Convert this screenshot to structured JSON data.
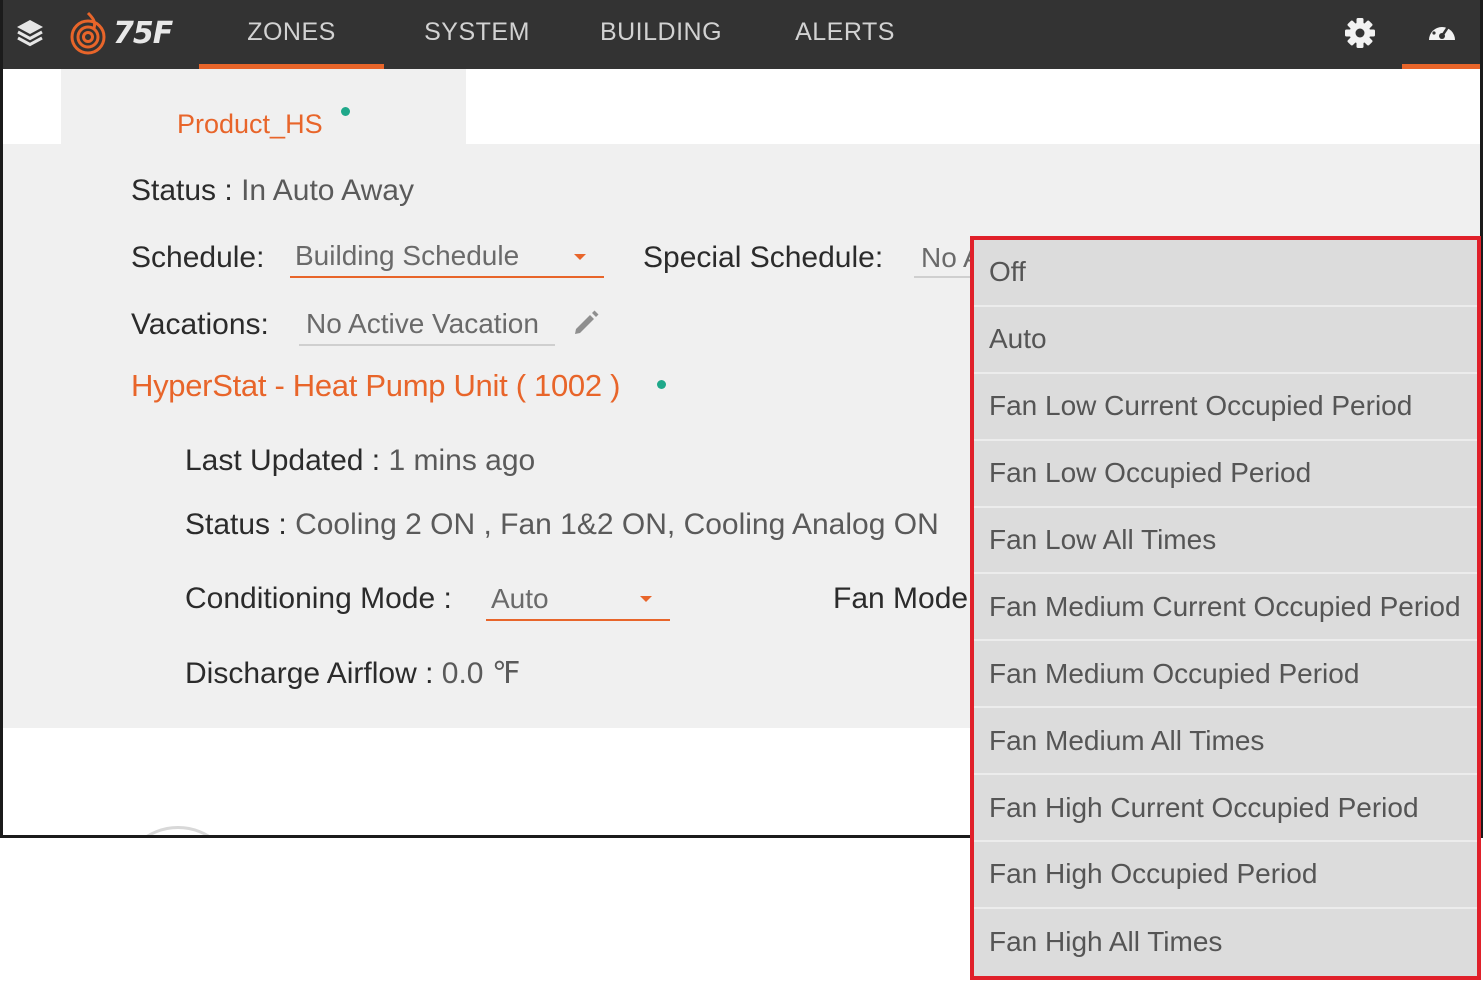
{
  "nav": {
    "brand": "75F",
    "tabs": [
      {
        "label": "ZONES",
        "active": true
      },
      {
        "label": "SYSTEM",
        "active": false
      },
      {
        "label": "BUILDING",
        "active": false
      },
      {
        "label": "ALERTS",
        "active": false
      }
    ],
    "icons": [
      "stack-icon",
      "gear-icon",
      "dashboard-icon"
    ],
    "accent_color": "#e8652a"
  },
  "zone": {
    "name": "Product_HS",
    "status_label": "Status :",
    "status_value": "In Auto Away",
    "schedule_label": "Schedule:",
    "schedule_value": "Building Schedule",
    "special_schedule_label": "Special Schedule:",
    "special_schedule_value": "No A",
    "vacations_label": "Vacations:",
    "vacations_value": "No Active Vacation"
  },
  "equipment": {
    "title": "HyperStat -  Heat Pump Unit ( 1002 )",
    "last_updated_label": "Last Updated :",
    "last_updated_value": "1 mins ago",
    "status_label": "Status :",
    "status_value": "Cooling 2 ON , Fan 1&2 ON, Cooling Analog ON",
    "conditioning_mode_label": "Conditioning Mode :",
    "conditioning_mode_value": "Auto",
    "fan_mode_label": "Fan Mode",
    "discharge_airflow_label": "Discharge Airflow :",
    "discharge_airflow_value": "0.0 ℉"
  },
  "fan_mode_menu": {
    "options": [
      "Off",
      "Auto",
      "Fan Low Current Occupied Period",
      "Fan Low Occupied Period",
      "Fan Low All Times",
      "Fan Medium Current Occupied Period",
      "Fan Medium Occupied Period",
      "Fan Medium All Times",
      "Fan High Current Occupied Period",
      "Fan High Occupied Period",
      "Fan High All Times"
    ],
    "highlight_color": "#e0202a"
  }
}
